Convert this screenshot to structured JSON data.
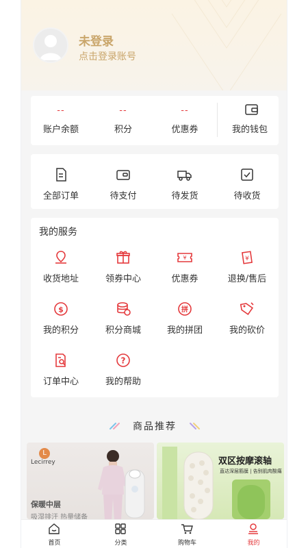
{
  "profile": {
    "title": "未登录",
    "subtitle": "点击登录账号"
  },
  "assets": {
    "items": [
      {
        "value": "--",
        "label": "账户余额"
      },
      {
        "value": "--",
        "label": "积分"
      },
      {
        "value": "--",
        "label": "优惠券"
      }
    ],
    "wallet_label": "我的钱包"
  },
  "orders": {
    "items": [
      {
        "label": "全部订单",
        "icon": "order-list-icon"
      },
      {
        "label": "待支付",
        "icon": "wallet-pay-icon"
      },
      {
        "label": "待发货",
        "icon": "truck-icon"
      },
      {
        "label": "待收货",
        "icon": "package-check-icon"
      }
    ]
  },
  "services": {
    "title": "我的服务",
    "items": [
      {
        "label": "收货地址",
        "icon": "map-pin-icon"
      },
      {
        "label": "领券中心",
        "icon": "gift-icon"
      },
      {
        "label": "优惠券",
        "icon": "ticket-icon"
      },
      {
        "label": "退换/售后",
        "icon": "refund-icon"
      },
      {
        "label": "我的积分",
        "icon": "dollar-coin-icon"
      },
      {
        "label": "积分商城",
        "icon": "coin-stack-icon"
      },
      {
        "label": "我的拼团",
        "icon": "group-buy-icon"
      },
      {
        "label": "我的砍价",
        "icon": "price-tag-icon"
      },
      {
        "label": "订单中心",
        "icon": "order-search-icon"
      },
      {
        "label": "我的帮助",
        "icon": "help-icon"
      }
    ]
  },
  "recommend": {
    "title": "商品推荐"
  },
  "banners": {
    "left": {
      "brand": "Lecirrey",
      "brand_mark": "L",
      "slogan": "保暖中层",
      "slogan2": "吸湿排汗  热量储备"
    },
    "right": {
      "title": "双区按摩滚轴",
      "subtitle": "直达深层筋膜 | 告别肌肉酸痛"
    }
  },
  "tabbar": {
    "items": [
      {
        "label": "首页",
        "icon": "home-icon"
      },
      {
        "label": "分类",
        "icon": "category-icon"
      },
      {
        "label": "购物车",
        "icon": "cart-icon"
      },
      {
        "label": "我的",
        "icon": "user-icon"
      }
    ]
  },
  "colors": {
    "accent": "#e4393c",
    "gold": "#c9a56a"
  }
}
